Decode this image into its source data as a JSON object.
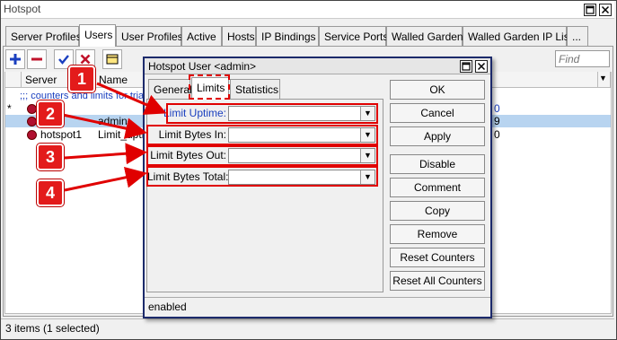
{
  "window": {
    "title": "Hotspot",
    "restore_icon": "restore-icon",
    "close_icon": "close-icon"
  },
  "tabs": [
    "Server Profiles",
    "Users",
    "User Profiles",
    "Active",
    "Hosts",
    "IP Bindings",
    "Service Ports",
    "Walled Garden",
    "Walled Garden IP List",
    "..."
  ],
  "toolbar": {
    "add_icon": "plus-icon",
    "remove_icon": "minus-icon",
    "enable_icon": "check-icon",
    "disable_icon": "x-icon",
    "comment_icon": "note-icon",
    "find_placeholder": "Find"
  },
  "table": {
    "columns": [
      "Server",
      "Name"
    ],
    "comment_row": ";;; counters and limits for trial",
    "rows": [
      {
        "marker": "*",
        "server": "",
        "name": ""
      },
      {
        "marker": "",
        "server": "",
        "name": "admin"
      },
      {
        "marker": "",
        "server": "hotspot1",
        "name": "Limit_uptime"
      }
    ],
    "right_values": [
      "0",
      "9",
      "0"
    ]
  },
  "status": "3 items (1 selected)",
  "dialog": {
    "title": "Hotspot User <admin>",
    "tabs": [
      "General",
      "Limits",
      "Statistics"
    ],
    "fields": [
      {
        "label": "Limit Uptime:",
        "value": ""
      },
      {
        "label": "Limit Bytes In:",
        "value": ""
      },
      {
        "label": "Limit Bytes Out:",
        "value": ""
      },
      {
        "label": "Limit Bytes Total:",
        "value": ""
      }
    ],
    "buttons": [
      "OK",
      "Cancel",
      "Apply",
      "Disable",
      "Comment",
      "Copy",
      "Remove",
      "Reset Counters",
      "Reset All Counters"
    ],
    "status": "enabled"
  },
  "annotations": {
    "badges": [
      "1",
      "2",
      "3",
      "4"
    ],
    "accent_color": "#e00000"
  }
}
